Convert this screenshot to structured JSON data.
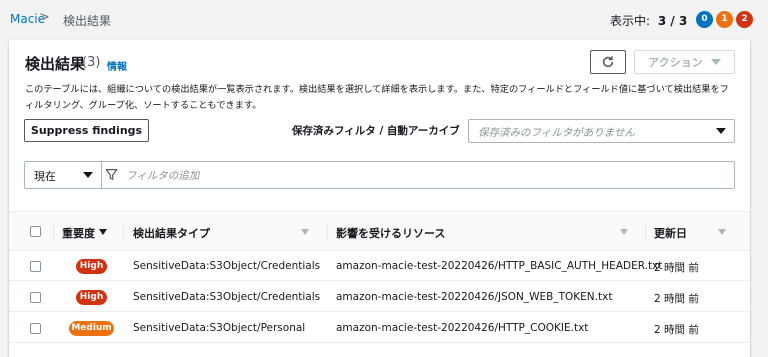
{
  "breadcrumb": {
    "root": "Macie",
    "separator": ">",
    "current": "検出結果"
  },
  "header_counts": {
    "label": "表示中:",
    "value": "3 / 3",
    "badges": [
      {
        "value": "0",
        "color": "#0073bb"
      },
      {
        "value": "1",
        "color": "#ec7211"
      },
      {
        "value": "2",
        "color": "#d13212"
      }
    ]
  },
  "panel": {
    "title": "検出結果",
    "count": "(3)",
    "info_link": "情報",
    "refresh_icon": "refresh-icon",
    "actions_label": "アクション",
    "description": "このテーブルには、組織についての検出結果が一覧表示されます。検出結果を選択して詳細を表示します。また、特定のフィールドとフィールド値に基づいて検出結果をフィルタリング、グループ化、ソートすることもできます。",
    "suppress_label": "Suppress findings",
    "saved_filters": {
      "label": "保存済みフィルタ / 自動アーカイブ",
      "placeholder": "保存済みのフィルタがありません"
    },
    "filter": {
      "scope": "現在",
      "placeholder": "フィルタの追加",
      "icon": "filter-icon"
    }
  },
  "table": {
    "columns": [
      "重要度",
      "検出結果タイプ",
      "影響を受けるリソース",
      "更新日"
    ],
    "rows": [
      {
        "severity": "High",
        "severity_color": "#d13212",
        "type": "SensitiveData:S3Object/Credentials",
        "resource": "amazon-macie-test-20220426/HTTP_BASIC_AUTH_HEADER.txt",
        "updated": "2 時間 前"
      },
      {
        "severity": "High",
        "severity_color": "#d13212",
        "type": "SensitiveData:S3Object/Credentials",
        "resource": "amazon-macie-test-20220426/JSON_WEB_TOKEN.txt",
        "updated": "2 時間 前"
      },
      {
        "severity": "Medium",
        "severity_color": "#ec7211",
        "type": "SensitiveData:S3Object/Personal",
        "resource": "amazon-macie-test-20220426/HTTP_COOKIE.txt",
        "updated": "2 時間 前"
      }
    ]
  }
}
